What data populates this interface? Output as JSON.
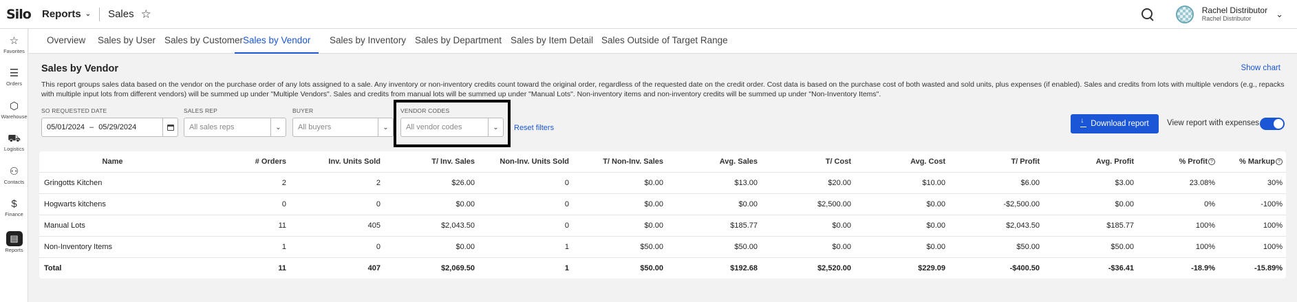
{
  "app": {
    "logo": "Silo",
    "module": "Reports",
    "page": "Sales"
  },
  "user": {
    "name": "Rachel Distributor",
    "company": "Rachel Distributor"
  },
  "sidebar": {
    "items": [
      {
        "label": "Favorites",
        "icon": "star-icon",
        "glyph": "☆"
      },
      {
        "label": "Orders",
        "icon": "clipboard-icon",
        "glyph": "📋"
      },
      {
        "label": "Warehouse",
        "icon": "cube-icon",
        "glyph": "⬡"
      },
      {
        "label": "Logistics",
        "icon": "truck-icon",
        "glyph": "⛟"
      },
      {
        "label": "Contacts",
        "icon": "people-icon",
        "glyph": "👥"
      },
      {
        "label": "Finance",
        "icon": "dollar-icon",
        "glyph": "$"
      },
      {
        "label": "Reports",
        "icon": "reports-icon",
        "glyph": "▤"
      }
    ]
  },
  "tabs": [
    "Overview",
    "Sales by User",
    "Sales by Customer",
    "Sales by Vendor",
    "Sales by Inventory",
    "Sales by Department",
    "Sales by Item Detail",
    "Sales Outside of Target Range"
  ],
  "active_tab": "Sales by Vendor",
  "report": {
    "title": "Sales by Vendor",
    "show_chart": "Show chart",
    "description": "This report groups sales data based on the vendor on the purchase order of any lots assigned to a sale. Any inventory or non-inventory credits count toward the original order, regardless of the requested date on the credit order. Cost data is based on the purchase cost of both wasted and sold units, plus expenses (if enabled). Sales and credits from lots with multiple vendors (e.g., repacks with multiple input lots from different vendors) will be summed up under \"Multiple Vendors\". Sales and credits from manual lots will be summed up under \"Manual Lots\". Non-inventory items and non-inventory credits will be summed up under \"Non-Inventory Items\"."
  },
  "filters": {
    "date": {
      "label": "SO REQUESTED DATE",
      "start": "05/01/2024",
      "sep": "–",
      "end": "05/29/2024"
    },
    "sales_rep": {
      "label": "SALES REP",
      "placeholder": "All sales reps"
    },
    "buyer": {
      "label": "BUYER",
      "placeholder": "All buyers"
    },
    "vendor_codes": {
      "label": "VENDOR CODES",
      "placeholder": "All vendor codes"
    },
    "reset": "Reset filters"
  },
  "actions": {
    "download": "Download report",
    "expenses_toggle_label": "View report with expenses",
    "expenses_on": true
  },
  "table": {
    "columns": [
      "Name",
      "# Orders",
      "Inv. Units Sold",
      "T/ Inv. Sales",
      "Non-Inv. Units Sold",
      "T/ Non-Inv. Sales",
      "Avg. Sales",
      "T/ Cost",
      "Avg. Cost",
      "T/ Profit",
      "Avg. Profit",
      "% Profit",
      "% Markup"
    ],
    "rows": [
      [
        "Gringotts Kitchen",
        "2",
        "2",
        "$26.00",
        "0",
        "$0.00",
        "$13.00",
        "$20.00",
        "$10.00",
        "$6.00",
        "$3.00",
        "23.08%",
        "30%"
      ],
      [
        "Hogwarts kitchens",
        "0",
        "0",
        "$0.00",
        "0",
        "$0.00",
        "$0.00",
        "$2,500.00",
        "$0.00",
        "-$2,500.00",
        "$0.00",
        "0%",
        "-100%"
      ],
      [
        "Manual Lots",
        "11",
        "405",
        "$2,043.50",
        "0",
        "$0.00",
        "$185.77",
        "$0.00",
        "$0.00",
        "$2,043.50",
        "$185.77",
        "100%",
        "100%"
      ],
      [
        "Non-Inventory Items",
        "1",
        "0",
        "$0.00",
        "1",
        "$50.00",
        "$50.00",
        "$0.00",
        "$0.00",
        "$50.00",
        "$50.00",
        "100%",
        "100%"
      ]
    ],
    "total": [
      "Total",
      "11",
      "407",
      "$2,069.50",
      "1",
      "$50.00",
      "$192.68",
      "$2,520.00",
      "$229.09",
      "-$400.50",
      "-$36.41",
      "-18.9%",
      "-15.89%"
    ]
  }
}
